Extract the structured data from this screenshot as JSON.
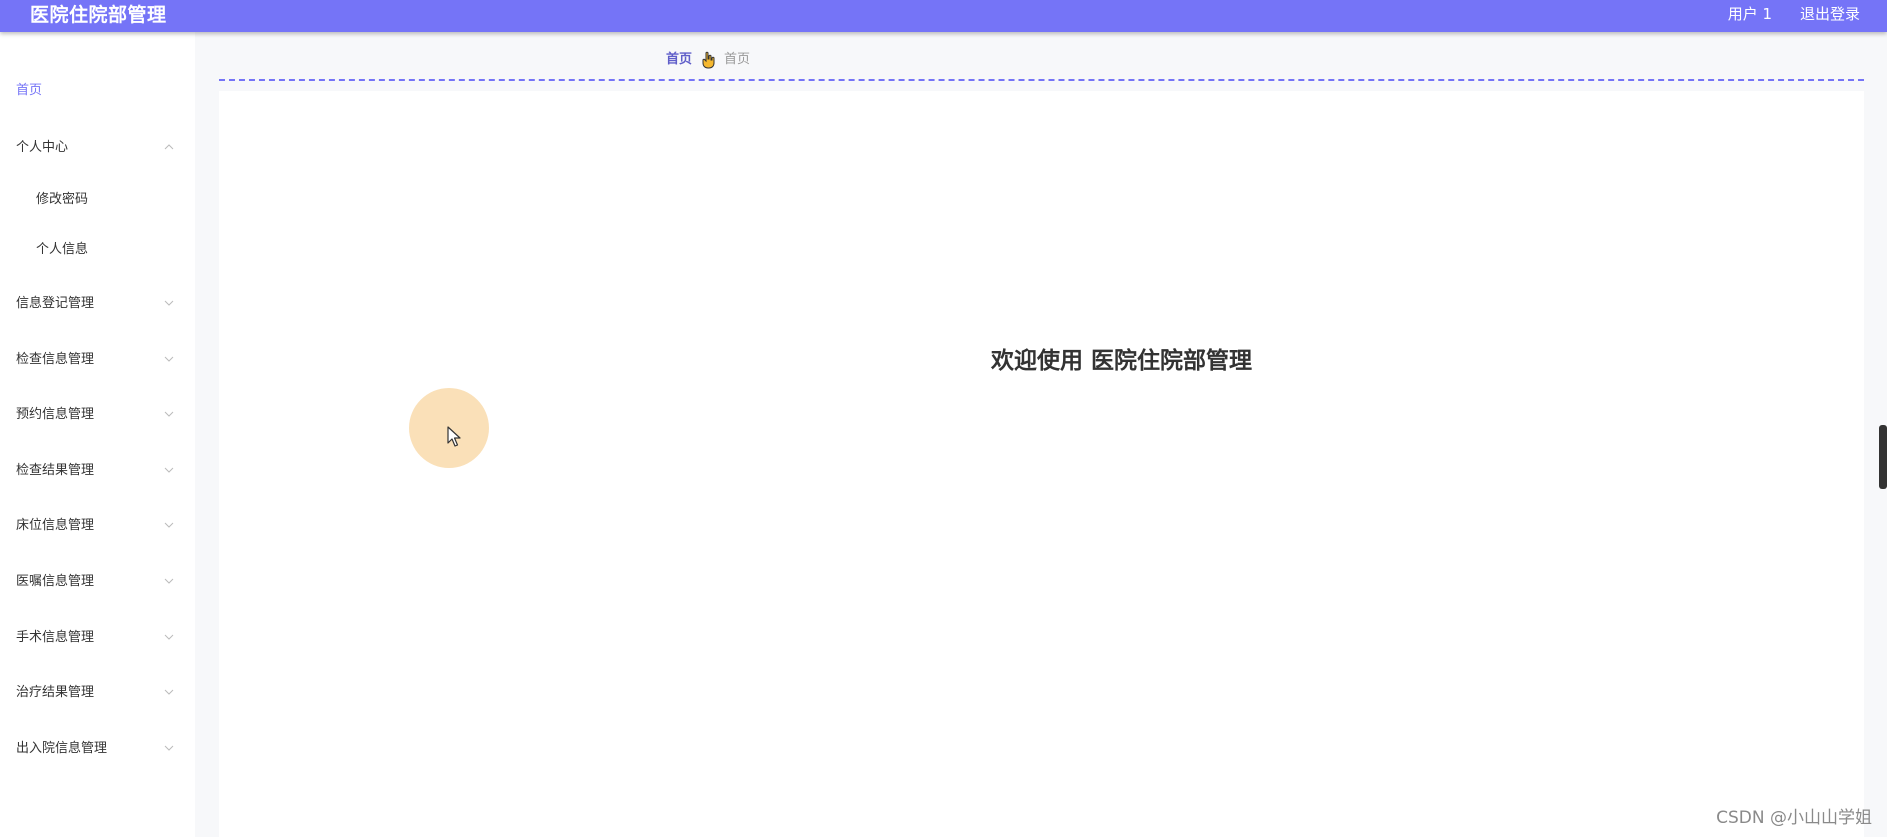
{
  "header": {
    "title": "医院住院部管理",
    "user_label": "用户 1",
    "logout_label": "退出登录"
  },
  "sidebar": {
    "items": [
      {
        "label": "首页",
        "active": true,
        "expandable": false
      },
      {
        "label": "个人中心",
        "expanded": true,
        "expandable": true
      },
      {
        "label": "修改密码",
        "sub": true
      },
      {
        "label": "个人信息",
        "sub": true
      },
      {
        "label": "信息登记管理",
        "expandable": true
      },
      {
        "label": "检查信息管理",
        "expandable": true
      },
      {
        "label": "预约信息管理",
        "expandable": true
      },
      {
        "label": "检查结果管理",
        "expandable": true
      },
      {
        "label": "床位信息管理",
        "expandable": true
      },
      {
        "label": "医嘱信息管理",
        "expandable": true
      },
      {
        "label": "手术信息管理",
        "expandable": true
      },
      {
        "label": "治疗结果管理",
        "expandable": true
      },
      {
        "label": "出入院信息管理",
        "expandable": true
      }
    ]
  },
  "breadcrumb": {
    "items": [
      "首页",
      "首页"
    ],
    "separator_icon": "hand-pointing-icon"
  },
  "main": {
    "welcome_text": "欢迎使用 医院住院部管理"
  },
  "watermark": "CSDN @小山山学姐",
  "colors": {
    "accent": "#7574f7",
    "cursor_halo": "#f8d5a0"
  }
}
